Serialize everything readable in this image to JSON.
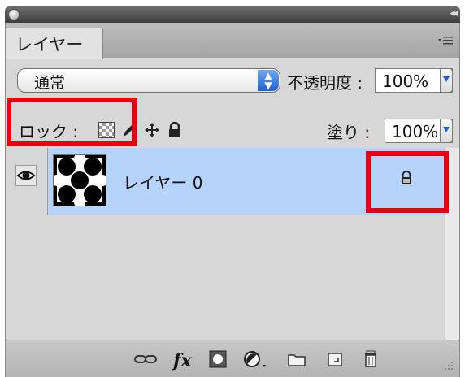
{
  "titlebar": {
    "collapse_glyph": "◂◂"
  },
  "tab": {
    "label": "レイヤー"
  },
  "panel_menu_icon": "panel-menu-icon",
  "blend_mode": {
    "value": "通常"
  },
  "opacity": {
    "label": "不透明度 :",
    "value": "100%"
  },
  "lock": {
    "label": "ロック :",
    "icons": [
      "lock-transparent-pixels-icon",
      "lock-image-pixels-icon",
      "lock-position-icon",
      "lock-all-icon"
    ]
  },
  "fill": {
    "label": "塗り :",
    "value": "100%"
  },
  "layers": [
    {
      "name": "レイヤー 0",
      "visible": true,
      "selected": true,
      "locked": true
    }
  ],
  "footer_icons": [
    "link-layers-icon",
    "fx-icon",
    "add-mask-icon",
    "adjustment-layer-icon",
    "new-group-icon",
    "new-layer-icon",
    "trash-icon"
  ],
  "footer_fx_text": "fx",
  "colors": {
    "highlight": "#e8000f",
    "selection": "#b6d3fb",
    "accent": "#1f5fd0"
  }
}
